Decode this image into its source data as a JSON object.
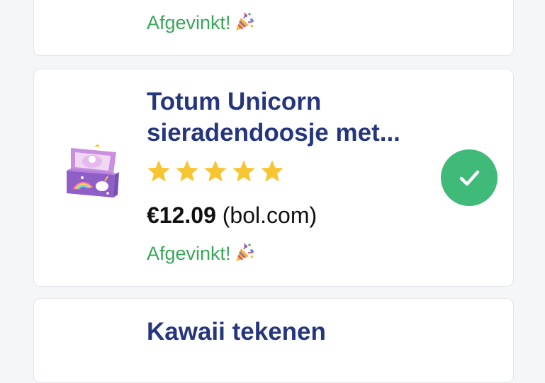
{
  "cards": [
    {
      "status_text": "Afgevinkt!",
      "status_icon": "party-popper-icon"
    },
    {
      "title": "Totum Unicorn sieradendoosje met...",
      "rating": 5,
      "rating_max": 5,
      "price": "€12.09",
      "store": "(bol.com)",
      "status_text": "Afgevinkt!",
      "status_icon": "party-popper-icon",
      "checked": true,
      "image_icon": "unicorn-jewelry-box-image"
    },
    {
      "title": "Kawaii tekenen"
    }
  ],
  "colors": {
    "title": "#26367e",
    "checked_text": "#3aa65a",
    "check_button": "#3fba79",
    "star": "#f7c531",
    "page_background": "#f5f6f8"
  }
}
